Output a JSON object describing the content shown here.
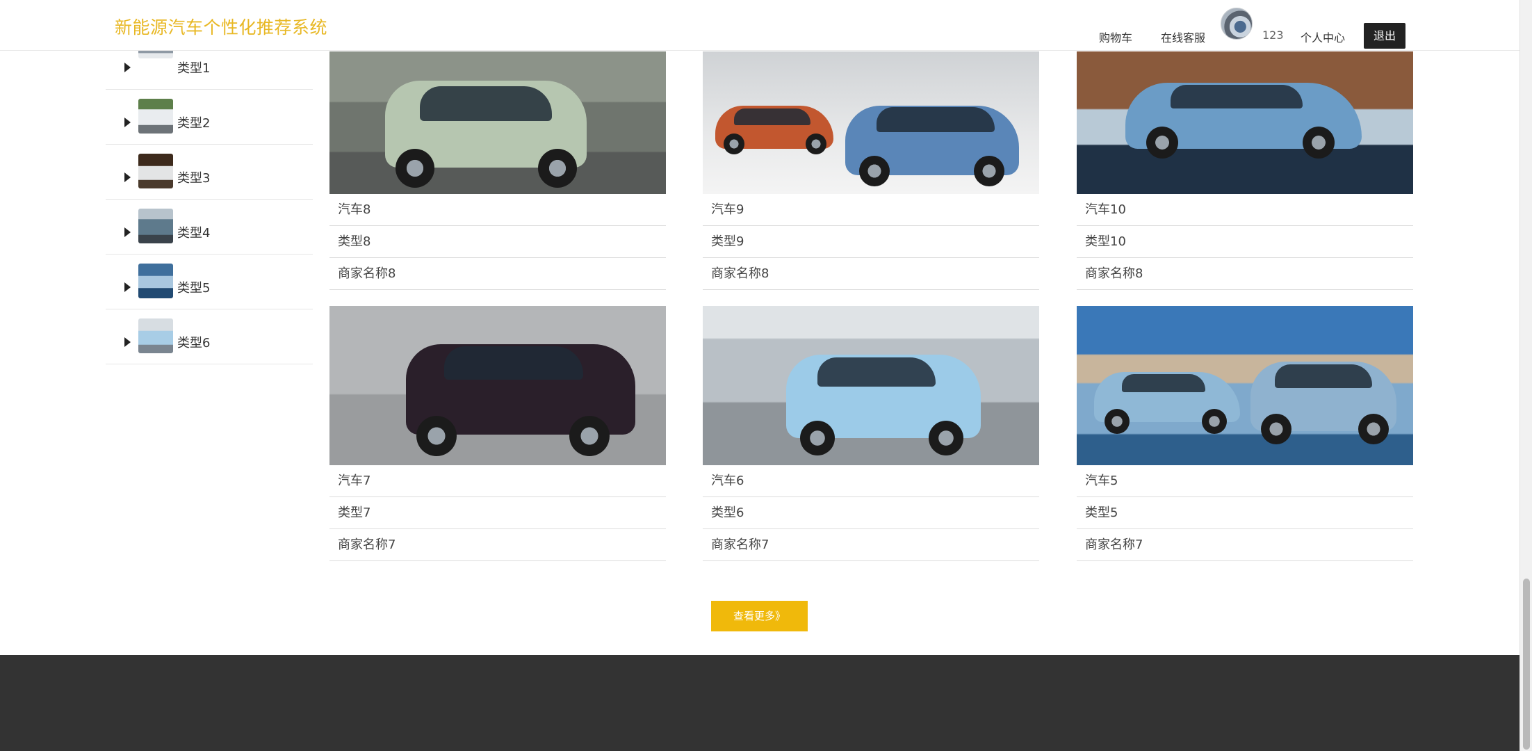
{
  "header": {
    "site_title": "新能源汽车个性化推荐系统",
    "cart_label": "购物车",
    "service_label": "在线客服",
    "username": "123",
    "profile_label": "个人中心",
    "logout_label": "退出"
  },
  "sidebar": {
    "items": [
      {
        "label": "类型1"
      },
      {
        "label": "类型2"
      },
      {
        "label": "类型3"
      },
      {
        "label": "类型4"
      },
      {
        "label": "类型5"
      },
      {
        "label": "类型6"
      }
    ]
  },
  "products": [
    {
      "name": "汽车8",
      "type": "类型8",
      "merchant": "商家名称8"
    },
    {
      "name": "汽车9",
      "type": "类型9",
      "merchant": "商家名称8"
    },
    {
      "name": "汽车10",
      "type": "类型10",
      "merchant": "商家名称8"
    },
    {
      "name": "汽车7",
      "type": "类型7",
      "merchant": "商家名称7"
    },
    {
      "name": "汽车6",
      "type": "类型6",
      "merchant": "商家名称7"
    },
    {
      "name": "汽车5",
      "type": "类型5",
      "merchant": "商家名称7"
    }
  ],
  "more_button": {
    "label": "查看更多》"
  },
  "colors": {
    "brand": "#e8b825",
    "more_button": "#f0b90b",
    "footer": "#333333",
    "logout_button": "#222222"
  }
}
